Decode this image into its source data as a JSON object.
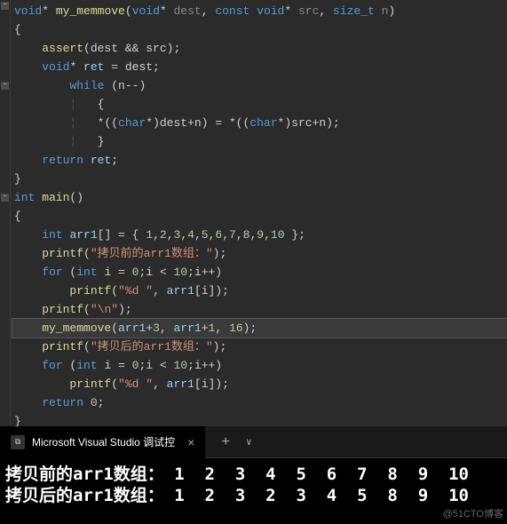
{
  "code": {
    "line1": {
      "t1": "void",
      "t2": "*",
      "t3": " my_memmove",
      "t4": "(",
      "t5": "void",
      "t6": "* ",
      "t7": "dest",
      "t8": ", ",
      "t9": "const",
      "t10": " void",
      "t11": "* ",
      "t12": "src",
      "t13": ", ",
      "t14": "size_t",
      "t15": " n",
      "t16": ")"
    },
    "line2": "{",
    "line3": {
      "pad": "    ",
      "t1": "assert",
      "t2": "(dest && src);"
    },
    "line4": {
      "pad": "    ",
      "t1": "void",
      "t2": "* ",
      "t3": "ret",
      "t4": " = dest;"
    },
    "line5": {
      "pad": "        ",
      "t1": "while",
      "t2": " (n--)"
    },
    "line6": {
      "pad": "        ",
      "pipe": "¦   ",
      "t1": "{"
    },
    "line7": {
      "pad": "        ",
      "pipe": "¦   ",
      "t1": "*((",
      "t2": "char",
      "t3": "*)dest+n) = *((",
      "t4": "char",
      "t5": "*)src+n);"
    },
    "line8": {
      "pad": "        ",
      "pipe": "¦   ",
      "t1": "}"
    },
    "line9": {
      "pad": "    ",
      "t1": "return",
      "t2": " ",
      "t3": "ret",
      "t4": ";"
    },
    "line10": "}",
    "line11": {
      "t1": "int",
      "t2": " main",
      "t3": "()"
    },
    "line12": "{",
    "line13": {
      "pad": "    ",
      "t1": "int",
      "t2": " ",
      "t3": "arr1",
      "t4": "[] = { ",
      "n1": "1",
      "c": ",",
      "n2": "2",
      "n3": "3",
      "n4": "4",
      "n5": "5",
      "n6": "6",
      "n7": "7",
      "n8": "8",
      "n9": "9",
      "n10": "10",
      "t5": " };"
    },
    "line14": {
      "pad": "    ",
      "t1": "printf",
      "t2": "(",
      "s": "\"拷贝前的arr1数组：\"",
      "t3": ");"
    },
    "line15": {
      "pad": "    ",
      "t1": "for",
      "t2": " (",
      "t3": "int",
      "t4": " i = ",
      "n1": "0",
      "t5": ";i < ",
      "n2": "10",
      "t6": ";i++)"
    },
    "line16": {
      "pad": "        ",
      "t1": "printf",
      "t2": "(",
      "s": "\"%d \"",
      "t3": ", ",
      "t4": "arr1",
      "t5": "[i]);"
    },
    "line17": {
      "pad": "    ",
      "t1": "printf",
      "t2": "(",
      "s": "\"\\n\"",
      "t3": ");"
    },
    "line18": {
      "pad": "    ",
      "t1": "my_memmove",
      "t2": "(",
      "t3": "arr1",
      "t4": "+",
      "n1": "3",
      "t5": ", ",
      "t6": "arr1",
      "t7": "+",
      "n2": "1",
      "t8": ", ",
      "n3": "16",
      "t9": ");"
    },
    "line19": {
      "pad": "    ",
      "t1": "printf",
      "t2": "(",
      "s": "\"拷贝后的arr1数组：\"",
      "t3": ");"
    },
    "line20": {
      "pad": "    ",
      "t1": "for",
      "t2": " (",
      "t3": "int",
      "t4": " i = ",
      "n1": "0",
      "t5": ";i < ",
      "n2": "10",
      "t6": ";i++)"
    },
    "line21": {
      "pad": "        ",
      "t1": "printf",
      "t2": "(",
      "s": "\"%d \"",
      "t3": ", ",
      "t4": "arr1",
      "t5": "[i]);"
    },
    "line22": {
      "pad": "    ",
      "t1": "return",
      "t2": " ",
      "n": "0",
      "t3": ";"
    },
    "line23": "}"
  },
  "tab": {
    "title": "Microsoft Visual Studio 调试控",
    "icon_glyph": "⧉"
  },
  "console": {
    "line1_label": "拷贝前的arr1数组：",
    "line1_values": "1  2  3  4  5  6  7  8  9  10",
    "line2_label": "拷贝后的arr1数组：",
    "line2_values": "1  2  3  2  3  4  5  8  9  10"
  },
  "watermark": "@51CTO博客",
  "nav": {
    "plus": "+",
    "close": "×",
    "chevron": "∨"
  }
}
